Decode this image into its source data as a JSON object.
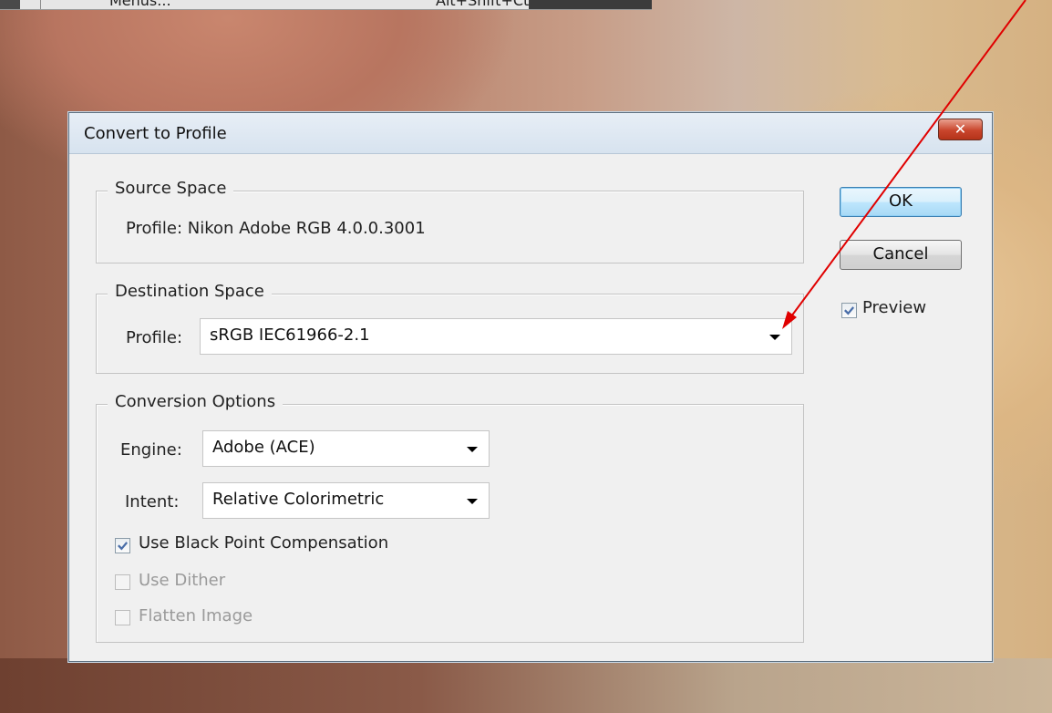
{
  "background_menu": {
    "item_label": "Menus...",
    "shortcut": "Alt+Shift+Ctrl+M"
  },
  "dialog": {
    "title": "Convert to Profile",
    "close_glyph": "✕",
    "source_space": {
      "legend": "Source Space",
      "profile_text": "Profile:  Nikon Adobe RGB 4.0.0.3001"
    },
    "destination_space": {
      "legend": "Destination Space",
      "profile_label": "Profile:",
      "profile_value": "sRGB IEC61966-2.1"
    },
    "conversion_options": {
      "legend": "Conversion Options",
      "engine_label": "Engine:",
      "engine_value": "Adobe (ACE)",
      "intent_label": "Intent:",
      "intent_value": "Relative Colorimetric",
      "black_point_label": "Use Black Point Compensation",
      "black_point_checked": true,
      "dither_label": "Use Dither",
      "dither_checked": false,
      "flatten_label": "Flatten Image",
      "flatten_checked": false
    },
    "buttons": {
      "ok": "OK",
      "cancel": "Cancel"
    },
    "preview_label": "Preview",
    "preview_checked": true
  },
  "colors": {
    "annotation_arrow": "#e00000",
    "close_button": "#c9452c",
    "default_button_border": "#3c7fb1"
  },
  "icons": {
    "close": "close-icon",
    "dropdown": "chevron-down-icon",
    "checkmark": "checkmark-icon"
  }
}
